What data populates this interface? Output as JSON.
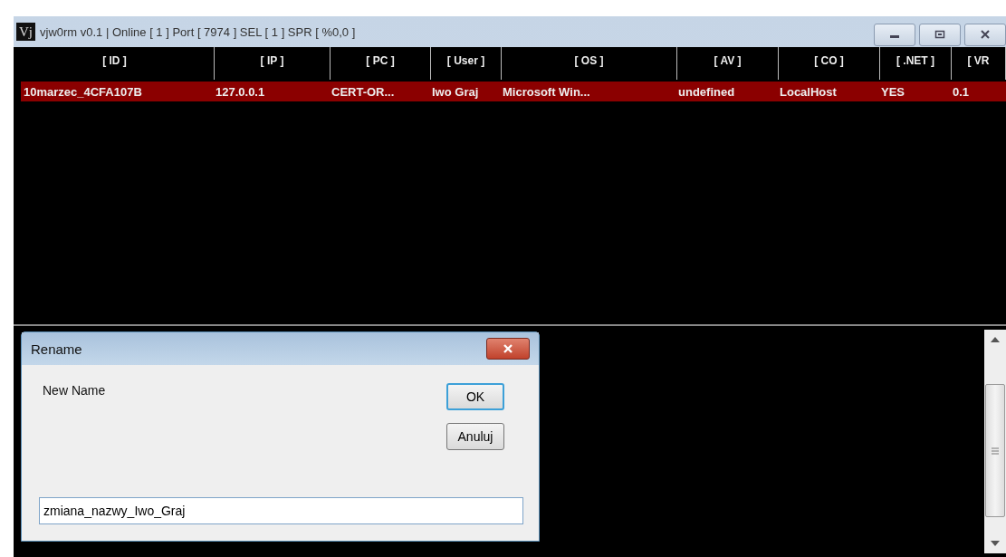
{
  "window": {
    "title": "vjw0rm v0.1 | Online [ 1 ] Port [ 7974 ] SEL [ 1 ] SPR [ %0,0 ]",
    "app_icon": "Vj"
  },
  "table": {
    "columns": [
      "[ ID ]",
      "[ IP ]",
      "[ PC ]",
      "[ User ]",
      "[ OS ]",
      "[ AV ]",
      "[ CO ]",
      "[ .NET ]",
      "[ VR"
    ],
    "rows": [
      {
        "selected": true,
        "cells": [
          "10marzec_4CFA107B",
          "127.0.0.1",
          "CERT-OR...",
          "Iwo Graj",
          "Microsoft Win...",
          "undefined",
          "LocalHost",
          "YES",
          "0.1"
        ]
      }
    ]
  },
  "dialog": {
    "title": "Rename",
    "label": "New Name",
    "buttons": [
      {
        "label": "OK",
        "kind": "default"
      },
      {
        "label": "Anuluj",
        "kind": "normal"
      }
    ],
    "input": {
      "value": "zmiana_nazwy_Iwo_Graj"
    }
  }
}
